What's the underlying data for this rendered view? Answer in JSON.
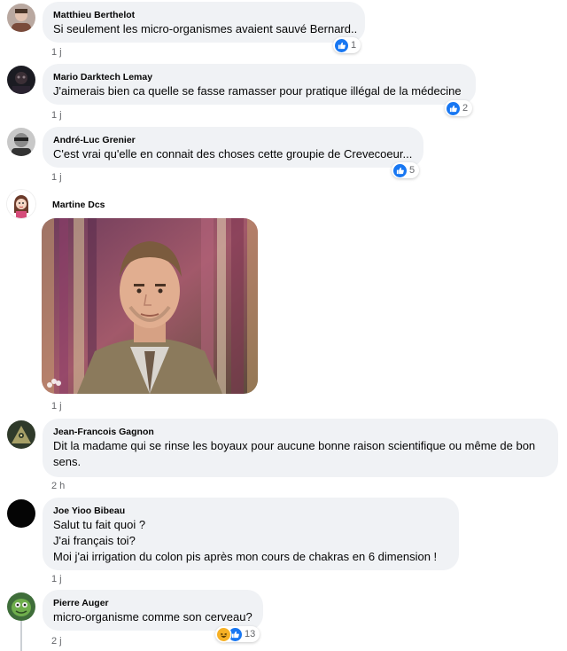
{
  "comments": [
    {
      "author": "Matthieu Berthelot",
      "lines": [
        "Si seulement les micro-organismes avaient sauvé Bernard.."
      ],
      "time": "1 j",
      "reactions": "1"
    },
    {
      "author": "Mario Darktech Lemay",
      "lines": [
        "J'aimerais bien ca quelle se fasse ramasser pour pratique illégal de la médecine"
      ],
      "time": "1 j",
      "reactions": "2"
    },
    {
      "author": "André-Luc Grenier",
      "lines": [
        "C'est vrai qu'elle en connait des choses cette groupie de Crevecoeur..."
      ],
      "time": "1 j",
      "reactions": "5"
    },
    {
      "author": "Martine Dcs",
      "lines": [],
      "time": "1 j",
      "reactions": ""
    },
    {
      "author": "Jean-Francois Gagnon",
      "lines": [
        "Dit la madame qui se rinse les boyaux pour aucune bonne raison scientifique ou même de bon",
        "sens."
      ],
      "time": "2 h",
      "reactions": ""
    },
    {
      "author": "Joe Yioo Bibeau",
      "lines": [
        "Salut tu fait quoi ?",
        "J'ai français toi?",
        "Moi j'ai irrigation du colon pis après mon cours de chakras en 6 dimension !"
      ],
      "time": "1 j",
      "reactions": ""
    },
    {
      "author": "Pierre Auger",
      "lines": [
        "micro-organisme comme son cerveau?"
      ],
      "time": "2 j",
      "reactions": "13"
    }
  ],
  "icons": {
    "like": "like-reaction-icon",
    "haha": "haha-reaction-icon",
    "gif": "gif-image"
  },
  "colors": {
    "bubble": "#f0f2f5",
    "like": "#1877f2",
    "meta": "#65676b"
  }
}
